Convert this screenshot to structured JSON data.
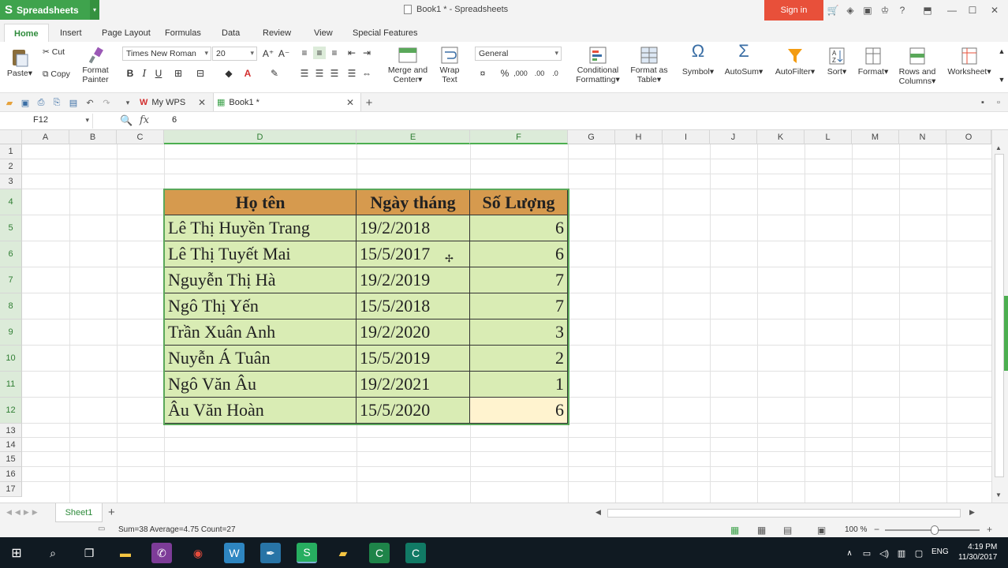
{
  "app": {
    "name": "Spreadsheets",
    "doc_title": "Book1 * - Spreadsheets",
    "signin": "Sign in"
  },
  "menu": {
    "tabs": [
      "Home",
      "Insert",
      "Page Layout",
      "Formulas",
      "Data",
      "Review",
      "View",
      "Special Features"
    ],
    "active": "Home"
  },
  "ribbon": {
    "paste": "Paste",
    "cut": "Cut",
    "copy": "Copy",
    "format_painter_1": "Format",
    "format_painter_2": "Painter",
    "font_name": "Times New Roman",
    "font_size": "20",
    "merge_1": "Merge and",
    "merge_2": "Center",
    "wrap_1": "Wrap",
    "wrap_2": "Text",
    "number_format": "General",
    "cond_1": "Conditional",
    "cond_2": "Formatting",
    "fmt_table_1": "Format as",
    "fmt_table_2": "Table",
    "symbol": "Symbol",
    "autosum": "AutoSum",
    "autofilter": "AutoFilter",
    "sort": "Sort",
    "format": "Format",
    "rows_cols_1": "Rows and",
    "rows_cols_2": "Columns",
    "worksheet": "Worksheet"
  },
  "doc_tabs": {
    "mywps": "My WPS",
    "book": "Book1 *"
  },
  "formula_bar": {
    "namebox": "F12",
    "fx": "fx",
    "value": "6"
  },
  "columns": [
    "A",
    "B",
    "C",
    "D",
    "E",
    "F",
    "G",
    "H",
    "I",
    "J",
    "K",
    "L",
    "M",
    "N",
    "O"
  ],
  "rows": [
    "1",
    "2",
    "3",
    "4",
    "5",
    "6",
    "7",
    "8",
    "9",
    "10",
    "11",
    "12",
    "13",
    "14",
    "15",
    "16",
    "17"
  ],
  "table": {
    "headers": [
      "Họ tên",
      "Ngày tháng",
      "Số Lượng"
    ],
    "rows": [
      [
        "Lê Thị Huyền Trang",
        "19/2/2018",
        "6"
      ],
      [
        "Lê Thị Tuyết Mai",
        "15/5/2017",
        "6"
      ],
      [
        "Nguyễn Thị Hà",
        "19/2/2019",
        "7"
      ],
      [
        "Ngô Thị Yến",
        "15/5/2018",
        "7"
      ],
      [
        "Trần Xuân Anh",
        "19/2/2020",
        "3"
      ],
      [
        "Nuyễn Á Tuân",
        "15/5/2019",
        "2"
      ],
      [
        "Ngô Văn Âu",
        "19/2/2021",
        "1"
      ],
      [
        "Âu Văn Hoàn",
        "15/5/2020",
        "6"
      ]
    ]
  },
  "sheet": {
    "tab": "Sheet1"
  },
  "status": {
    "text": "Sum=38  Average=4.75  Count=27",
    "zoom": "100 %"
  },
  "taskbar": {
    "lang": "ENG",
    "time": "4:19 PM",
    "date": "11/30/2017"
  },
  "colors": {
    "accent": "#3fa34d",
    "header_fill": "#d69a4e",
    "body_fill": "#d9ecb4",
    "active_fill": "#fff3cf",
    "signin": "#e8503a"
  }
}
